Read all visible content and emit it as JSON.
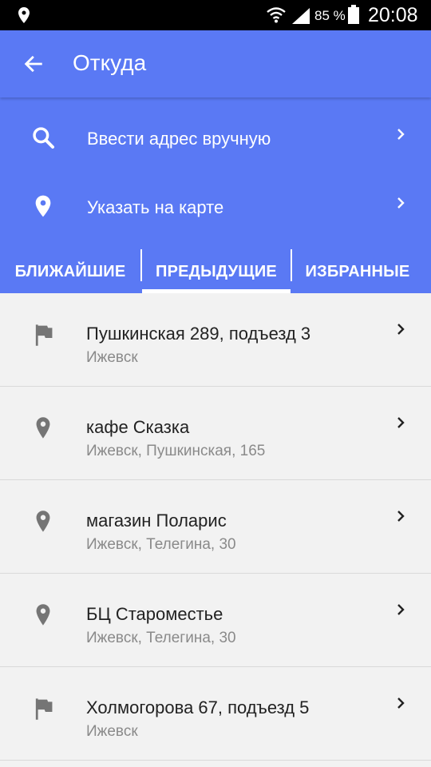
{
  "status_bar": {
    "battery": "85 %",
    "time": "20:08"
  },
  "appbar": {
    "title": "Откуда"
  },
  "panel": {
    "actions": [
      {
        "label": "Ввести адрес вручную",
        "icon": "search-icon"
      },
      {
        "label": "Указать на карте",
        "icon": "location-pin-icon"
      }
    ]
  },
  "tabs": {
    "items": [
      {
        "label": "БЛИЖАЙШИЕ"
      },
      {
        "label": "ПРЕДЫДУЩИЕ",
        "selected": true
      },
      {
        "label": "ИЗБРАННЫЕ"
      }
    ]
  },
  "list": {
    "items": [
      {
        "primary": "Пушкинская 289, подъезд 3",
        "secondary": "Ижевск",
        "icon": "flag-icon"
      },
      {
        "primary": "кафе Сказка",
        "secondary": "Ижевск, Пушкинская, 165",
        "icon": "location-pin-icon"
      },
      {
        "primary": "магазин Поларис",
        "secondary": "Ижевск, Телегина, 30",
        "icon": "location-pin-icon"
      },
      {
        "primary": "БЦ Староместье",
        "secondary": "Ижевск, Телегина, 30",
        "icon": "location-pin-icon"
      },
      {
        "primary": "Холмогорова 67, подъезд 5",
        "secondary": "Ижевск",
        "icon": "flag-icon"
      }
    ]
  },
  "colors": {
    "primary": "#5a79f4",
    "background": "#f2f2f2",
    "text_primary": "#222222",
    "text_secondary": "#8a8a8a",
    "icon_gray": "#757575"
  }
}
